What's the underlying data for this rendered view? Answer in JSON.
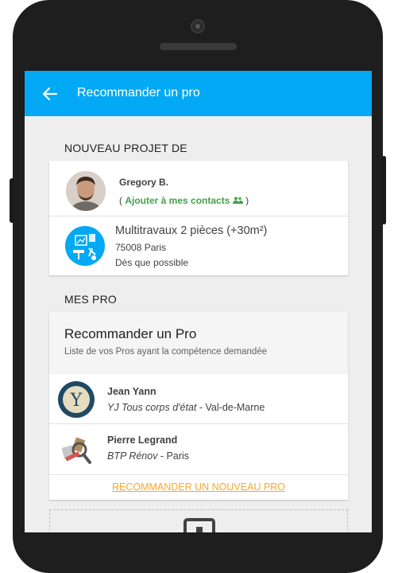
{
  "app_bar": {
    "title": "Recommander un pro"
  },
  "project_section": {
    "header": "NOUVEAU PROJET DE",
    "client": {
      "name": "Gregory B.",
      "open_paren": "(",
      "add_contact_label": "Ajouter à mes contacts",
      "close_paren": ")"
    },
    "project": {
      "title": "Multitravaux 2 pièces (+30m²)",
      "location": "75008 Paris",
      "timing": "Dès que possible"
    }
  },
  "pros_section": {
    "header": "MES PRO",
    "card_title": "Recommander un Pro",
    "card_subtitle": "Liste de vos Pros ayant la compétence demandée",
    "pros": [
      {
        "name": "Jean Yann",
        "company": "YJ Tous corps d'état",
        "region": " - Val-de-Marne"
      },
      {
        "name": "Pierre Legrand",
        "company": "BTP Rénov",
        "region": " - Paris"
      }
    ],
    "new_pro_link": "RECOMMANDER UN NOUVEAU PRO"
  },
  "colors": {
    "app_bar": "#03a9f4",
    "accent_green": "#43a047",
    "link_orange": "#f9a825"
  }
}
